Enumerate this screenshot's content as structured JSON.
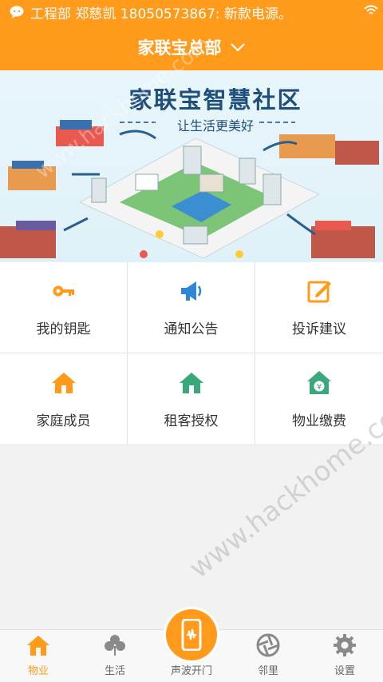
{
  "status_bar": {
    "notification": "工程部 郑慈凯 18050573867: 新款电源。"
  },
  "header": {
    "title": "家联宝总部"
  },
  "banner": {
    "headline": "家联宝智慧社区",
    "subheadline": "让生活更美好"
  },
  "menu": {
    "items": [
      {
        "label": "我的钥匙",
        "icon": "key-icon"
      },
      {
        "label": "通知公告",
        "icon": "megaphone-icon"
      },
      {
        "label": "投诉建议",
        "icon": "edit-icon"
      },
      {
        "label": "家庭成员",
        "icon": "house-icon"
      },
      {
        "label": "租客授权",
        "icon": "house-icon"
      },
      {
        "label": "物业缴费",
        "icon": "house-yuan-icon"
      }
    ]
  },
  "bottom_nav": {
    "items": [
      {
        "label": "物业",
        "icon": "home-icon",
        "active": true
      },
      {
        "label": "生活",
        "icon": "clover-icon",
        "active": false
      },
      {
        "label": "声波开门",
        "icon": "phone-sound-icon",
        "active": false
      },
      {
        "label": "邻里",
        "icon": "aperture-icon",
        "active": false
      },
      {
        "label": "设置",
        "icon": "gear-icon",
        "active": false
      }
    ]
  },
  "watermark": "www.hackhome.com",
  "colors": {
    "accent": "#ff9a1a",
    "icon_blue": "#2f86d6",
    "icon_green": "#3aa87a"
  }
}
